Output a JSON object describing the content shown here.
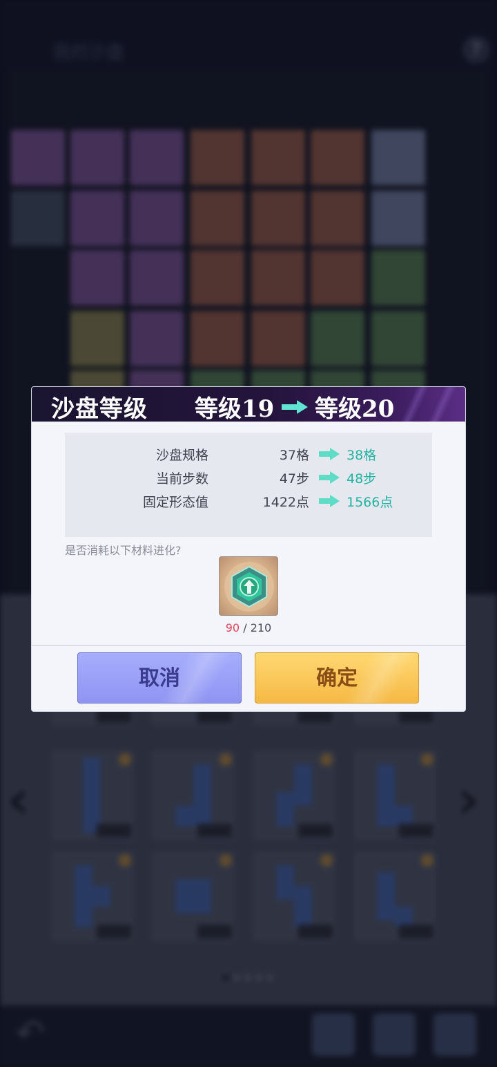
{
  "background": {
    "title": "我的沙盘",
    "help_icon": "?"
  },
  "dialog": {
    "title": "沙盘等级",
    "level_from": "等级19",
    "level_to": "等级20",
    "stats": [
      {
        "label": "沙盘规格",
        "old": "37格",
        "new": "38格"
      },
      {
        "label": "当前步数",
        "old": "47步",
        "new": "48步"
      },
      {
        "label": "固定形态值",
        "old": "1422点",
        "new": "1566点"
      }
    ],
    "prompt": "是否消耗以下材料进化?",
    "material": {
      "icon": "evolution-crystal-icon",
      "have": "90",
      "sep": "/",
      "need": "210"
    },
    "buttons": {
      "cancel": "取消",
      "confirm": "确定"
    }
  },
  "colors": {
    "accent_new_value": "#26b3a1",
    "insufficient": "#e0455a",
    "cancel_button": "#9aa0f8",
    "confirm_button": "#fbc65a"
  }
}
